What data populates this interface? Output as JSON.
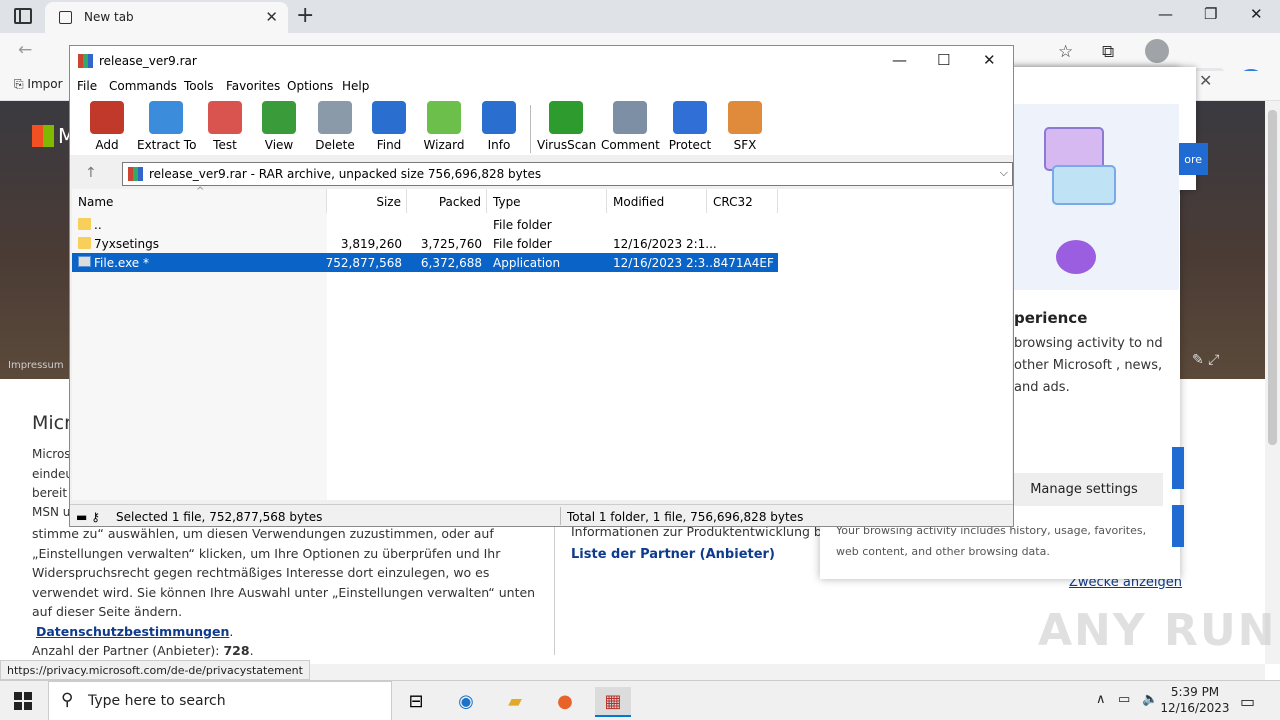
{
  "browser": {
    "tab_title": "New tab",
    "favorites_item": "Impor",
    "page": {
      "hero_text": "M",
      "impressum": "Impressum",
      "title": "Micr",
      "left_fragments": [
        "Micros",
        "eindeu",
        "bereit",
        "MSN u"
      ],
      "paragraph_before_link": "stimme zu“ auswählen, um diesen Verwendungen zuzustimmen, oder auf „Einstellungen verwalten“ klicken, um Ihre Optionen zu überprüfen und Ihr Widerspruchsrecht gegen rechtmäßiges Interesse dort einzulegen, wo es verwendet wird.  Sie können Ihre Auswahl unter „Einstellungen verwalten“ unten auf dieser Seite ändern.",
      "privacy_link": "Datenschutzbestimmungen",
      "partner_count_label": "Anzahl der Partner (Anbieter):",
      "partner_count": "728",
      "right_text": "Informationen zur Produktentwicklung bere",
      "partner_list_link": "Liste der Partner (Anbieter)",
      "zwecke_link": "Zwecke anzeigen"
    },
    "popup": {
      "heading_fragment": "perience",
      "text_fragment": "browsing activity to nd other Microsoft , news, and ads.",
      "button_fragment": "ore",
      "manage_settings": "Manage settings",
      "footer": "Your browsing activity includes history, usage, favorites, web content, and other browsing data."
    },
    "status_url": "https://privacy.microsoft.com/de-de/privacystatement"
  },
  "winrar": {
    "title": "release_ver9.rar",
    "menu": [
      "File",
      "Commands",
      "Tools",
      "Favorites",
      "Options",
      "Help"
    ],
    "toolbar": [
      {
        "label": "Add",
        "icon": "add-books-icon",
        "color": "#c0392b"
      },
      {
        "label": "Extract To",
        "icon": "extract-folder-icon",
        "color": "#3b8ddc"
      },
      {
        "label": "Test",
        "icon": "test-clipboard-icon",
        "color": "#d9534f"
      },
      {
        "label": "View",
        "icon": "view-book-icon",
        "color": "#3a9b3a"
      },
      {
        "label": "Delete",
        "icon": "delete-bin-icon",
        "color": "#8a9aa8"
      },
      {
        "label": "Find",
        "icon": "find-magnifier-icon",
        "color": "#2a6fd0"
      },
      {
        "label": "Wizard",
        "icon": "wizard-wand-icon",
        "color": "#6bbf4a"
      },
      {
        "label": "Info",
        "icon": "info-icon",
        "color": "#2a6fd0"
      },
      {
        "label": "VirusScan",
        "icon": "virusscan-bug-icon",
        "color": "#2e9b2e"
      },
      {
        "label": "Comment",
        "icon": "comment-icon",
        "color": "#7d8fa5"
      },
      {
        "label": "Protect",
        "icon": "protect-shield-icon",
        "color": "#2f6fd6"
      },
      {
        "label": "SFX",
        "icon": "sfx-box-icon",
        "color": "#e08a3c"
      }
    ],
    "path": "release_ver9.rar - RAR archive, unpacked size 756,696,828 bytes",
    "columns": [
      "Name",
      "Size",
      "Packed",
      "Type",
      "Modified",
      "CRC32"
    ],
    "rows": [
      {
        "name": "..",
        "size": "",
        "packed": "",
        "type": "File folder",
        "modified": "",
        "crc": "",
        "kind": "folder",
        "selected": false
      },
      {
        "name": "7yxsetings",
        "size": "3,819,260",
        "packed": "3,725,760",
        "type": "File folder",
        "modified": "12/16/2023 2:1...",
        "crc": "",
        "kind": "folder",
        "selected": false
      },
      {
        "name": "File.exe *",
        "size": "752,877,568",
        "packed": "6,372,688",
        "type": "Application",
        "modified": "12/16/2023 2:3...",
        "crc": "8471A4EF",
        "kind": "exe",
        "selected": true
      }
    ],
    "status_left": "Selected 1 file, 752,877,568 bytes",
    "status_right": "Total 1 folder, 1 file, 756,696,828 bytes"
  },
  "taskbar": {
    "search_placeholder": "Type here to search",
    "time": "5:39 PM",
    "date": "12/16/2023"
  },
  "watermark": "ANY RUN"
}
